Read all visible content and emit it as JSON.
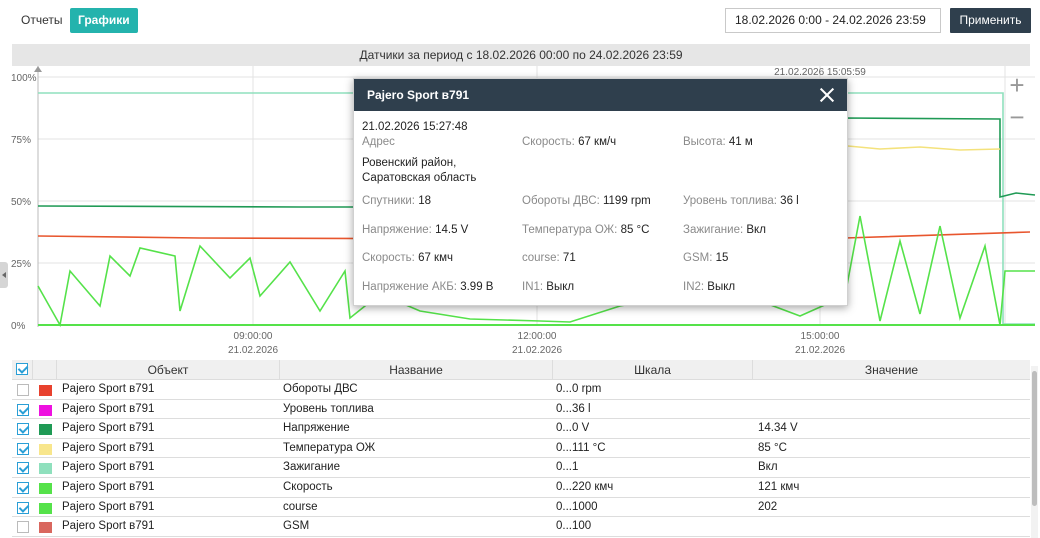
{
  "tabs": {
    "reports": "Отчеты",
    "charts": "Графики"
  },
  "period_value": "18.02.2026 0:00 - 24.02.2026 23:59",
  "apply_label": "Применить",
  "chart_header": "Датчики за период с 18.02.2026 00:00 по 24.02.2026 23:59",
  "zoom": {
    "in": "+",
    "out": "−"
  },
  "chart_data": {
    "type": "line",
    "y_ticks": [
      "100%",
      "75%",
      "50%",
      "25%",
      "0%"
    ],
    "x_ticks": [
      {
        "time": "09:00:00",
        "date": "21.02.2026"
      },
      {
        "time": "12:00:00",
        "date": "21.02.2026"
      },
      {
        "time": "15:00:00",
        "date": "21.02.2026"
      }
    ],
    "cursor_label": "21.02.2026 15:05:59",
    "ylim": [
      0,
      100
    ],
    "series": [
      {
        "name": "Напряжение",
        "color": "#1f9a55",
        "values": [
          45,
          45,
          44.5,
          44.5,
          44.5,
          44.5,
          44.5,
          44.5,
          44.5,
          86,
          85.5,
          85.5,
          85,
          50
        ]
      },
      {
        "name": "Температура ОЖ",
        "color": "#f4e27c",
        "values": [
          null,
          null,
          null,
          null,
          null,
          null,
          null,
          null,
          null,
          76,
          75,
          74,
          74,
          null
        ]
      },
      {
        "name": "Обороты ДВС",
        "color": "#e8562e",
        "values": [
          37,
          36,
          36,
          35.5,
          35.5,
          35,
          35,
          35,
          35,
          35,
          35,
          35,
          35,
          35
        ]
      },
      {
        "name": "Зажигание",
        "color": "#8fe0bd",
        "values": [
          100,
          100,
          100,
          100,
          100,
          100,
          100,
          100,
          100,
          100,
          100,
          100,
          100,
          0
        ]
      },
      {
        "name": "Скорость",
        "color": "#55e24a",
        "values": [
          20,
          25,
          5,
          25,
          15,
          28,
          10,
          25,
          0,
          40,
          10,
          35,
          15,
          20
        ]
      }
    ]
  },
  "popup": {
    "title": "Pajero Sport в791",
    "datetime": "21.02.2026 15:27:48",
    "address_label": "Адрес",
    "address_value": "Ровенский район, Саратовская область",
    "fields": [
      {
        "label": "Скорость:",
        "value": "67 км/ч"
      },
      {
        "label": "Высота:",
        "value": "41 м"
      },
      {
        "label": "Спутники:",
        "value": "18"
      },
      {
        "label": "Обороты ДВС:",
        "value": "1199 rpm"
      },
      {
        "label": "Уровень топлива:",
        "value": "36 l"
      },
      {
        "label": "Напряжение:",
        "value": "14.5 V"
      },
      {
        "label": "Температура ОЖ:",
        "value": "85 °C"
      },
      {
        "label": "Зажигание:",
        "value": "Вкл"
      },
      {
        "label": "Скорость:",
        "value": "67 кмч"
      },
      {
        "label": "course:",
        "value": "71"
      },
      {
        "label": "GSM:",
        "value": "15"
      },
      {
        "label": "Напряжение АКБ:",
        "value": "3.99 В"
      },
      {
        "label": "IN1:",
        "value": "Выкл"
      },
      {
        "label": "IN2:",
        "value": "Выкл"
      }
    ]
  },
  "table": {
    "headers": [
      "Объект",
      "Название",
      "Шкала",
      "Значение"
    ],
    "rows": [
      {
        "checked": false,
        "color": "#e8412e",
        "object": "Pajero Sport в791",
        "name": "Обороты ДВС",
        "scale": "0...0 rpm",
        "value": ""
      },
      {
        "checked": true,
        "color": "#ee11e0",
        "object": "Pajero Sport в791",
        "name": "Уровень топлива",
        "scale": "0...36 l",
        "value": ""
      },
      {
        "checked": true,
        "color": "#1f9a55",
        "object": "Pajero Sport в791",
        "name": "Напряжение",
        "scale": "0...0 V",
        "value": "14.34 V"
      },
      {
        "checked": true,
        "color": "#f8e68c",
        "object": "Pajero Sport в791",
        "name": "Температура ОЖ",
        "scale": "0...111 °C",
        "value": "85 °C"
      },
      {
        "checked": true,
        "color": "#8fe0bd",
        "object": "Pajero Sport в791",
        "name": "Зажигание",
        "scale": "0...1",
        "value": "Вкл"
      },
      {
        "checked": true,
        "color": "#55e24a",
        "object": "Pajero Sport в791",
        "name": "Скорость",
        "scale": "0...220 кмч",
        "value": "121 кмч"
      },
      {
        "checked": true,
        "color": "#55e24a",
        "object": "Pajero Sport в791",
        "name": "course",
        "scale": "0...1000",
        "value": "202"
      },
      {
        "checked": false,
        "color": "#d9675e",
        "object": "Pajero Sport в791",
        "name": "GSM",
        "scale": "0...100",
        "value": ""
      }
    ]
  }
}
